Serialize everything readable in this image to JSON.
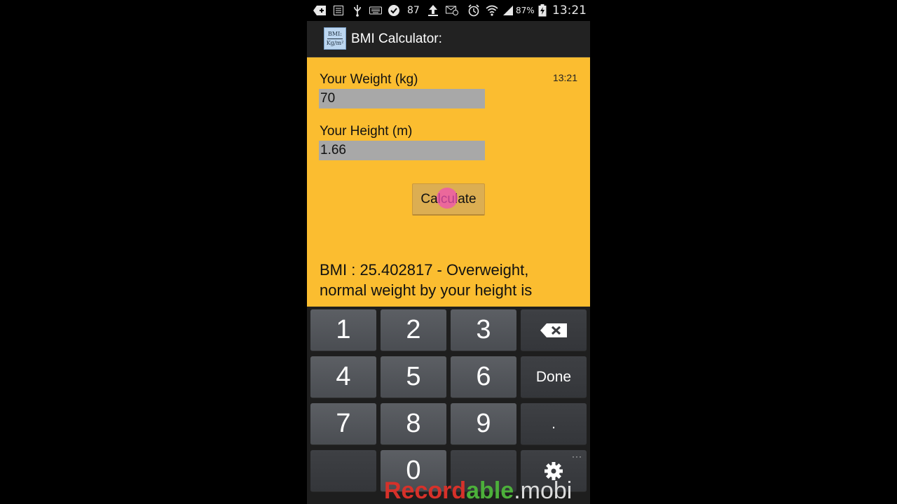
{
  "status_bar": {
    "notification_count": "87",
    "battery": "87%",
    "time": "13:21"
  },
  "action_bar": {
    "icon_top": "BMI:",
    "icon_bottom": "Kg/m²",
    "title": "BMI Calculator:"
  },
  "content": {
    "clock": "13:21",
    "weight_label": "Your Weight (kg)",
    "weight_value": "70",
    "height_label": "Your Height (m)",
    "height_value": "1.66",
    "calculate_label": "Calculate",
    "result": "BMI : 25.402817 - Overweight, normal weight by your height is"
  },
  "keyboard": {
    "k1": "1",
    "k2": "2",
    "k3": "3",
    "k4": "4",
    "k5": "5",
    "k6": "6",
    "k7": "7",
    "k8": "8",
    "k9": "9",
    "k0": "0",
    "done": "Done",
    "dot": ".",
    "more": "···"
  },
  "watermark": {
    "part1": "Record",
    "part2": "able",
    "part3": ".mobi"
  },
  "colors": {
    "content_bg": "#fbbd30",
    "action_bar_bg": "#222222",
    "key_bg": "#54575c",
    "touch_indicator": "#f050b4"
  }
}
